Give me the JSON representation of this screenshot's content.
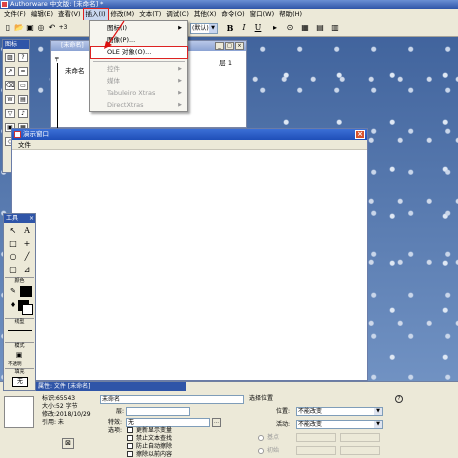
{
  "window": {
    "title": "Authorware 中文版: [未命名] *"
  },
  "menubar": {
    "items": [
      "文件(F)",
      "编辑(E)",
      "查看(V)",
      "插入(I)",
      "修改(M)",
      "文本(T)",
      "调试(C)",
      "其他(X)",
      "命令(O)",
      "窗口(W)",
      "帮助(H)"
    ],
    "active_index": 3
  },
  "toolbar": {
    "font_combo": "+3",
    "size_combo": "(默认)",
    "bold": "B",
    "italic": "I",
    "underline": "U"
  },
  "insert_menu": {
    "items": [
      {
        "label": "图标(I)",
        "has_sub": true,
        "disabled": false
      },
      {
        "label": "图像(P)...",
        "has_sub": false,
        "disabled": false
      },
      {
        "label": "OLE 对象(O)...",
        "has_sub": false,
        "disabled": false,
        "highlight": true
      },
      {
        "label": "控件",
        "has_sub": true,
        "disabled": true
      },
      {
        "label": "媒体",
        "has_sub": true,
        "disabled": true
      },
      {
        "label": "Tabuleiro Xtras",
        "has_sub": true,
        "disabled": true
      },
      {
        "label": "DirectXtras",
        "has_sub": true,
        "disabled": true
      }
    ]
  },
  "palette": {
    "title": "图标"
  },
  "flowline": {
    "title": "[未命名]",
    "item_label": "未命名",
    "level": "层 1"
  },
  "presentation": {
    "title": "演示窗口",
    "menu_file": "文件"
  },
  "tools": {
    "title": "工具",
    "sections": [
      "颜色",
      "线型",
      "模式",
      "填充"
    ],
    "mode_label": "不透明",
    "fill_label": "无"
  },
  "properties": {
    "title": "属性: 文件 [未命名]",
    "id_label": "标识:65543",
    "size_label": "大小:52 字节",
    "modified_label": "修改:2018/10/29",
    "ref_label": "引用: 未",
    "name_value": "未命名",
    "layer_label": "层:",
    "effect_label": "特效:",
    "effect_value": "无",
    "options_label": "选项:",
    "check1": "更新显示变量",
    "check2": "禁止文本查找",
    "check3": "防止自动擦除",
    "check4": "擦除以前内容",
    "position_header": "选择位置",
    "position_label": "位置:",
    "position_value": "不能改变",
    "active_label": "活动:",
    "active_value": "不能改变",
    "radio1": "基点",
    "radio2": "初始"
  }
}
